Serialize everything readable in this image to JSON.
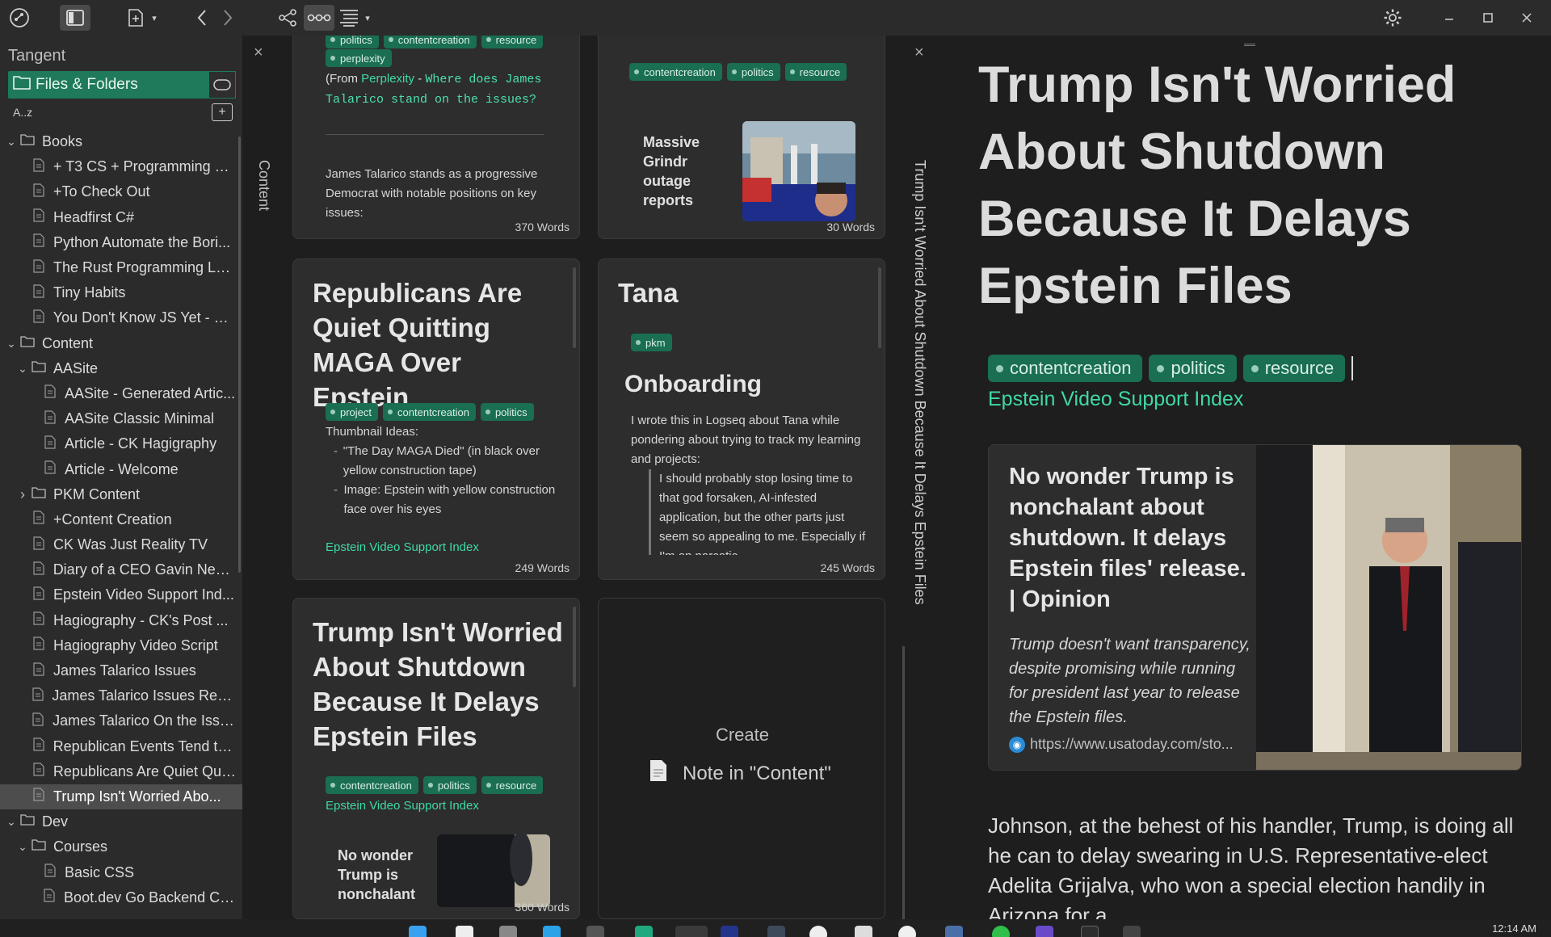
{
  "app": {
    "title": "Tangent"
  },
  "toolbar": {
    "icons": [
      "tangent-logo-icon",
      "sidebar-toggle-icon",
      "new-note-icon",
      "back-icon",
      "forward-icon",
      "graph-icon",
      "link-icon",
      "outline-icon",
      "settings-icon",
      "minimize-icon",
      "maximize-icon",
      "close-icon"
    ]
  },
  "sidebar": {
    "files_tab_label": "Files & Folders",
    "sort_label": "A..z",
    "tree": [
      {
        "label": "Books",
        "type": "folder",
        "depth": 0,
        "expanded": true
      },
      {
        "label": "+ T3 CS + Programming B...",
        "type": "file",
        "depth": 1
      },
      {
        "label": "+To Check Out",
        "type": "file",
        "depth": 1
      },
      {
        "label": "Headfirst C#",
        "type": "file",
        "depth": 1
      },
      {
        "label": "Python Automate the Bori...",
        "type": "file",
        "depth": 1
      },
      {
        "label": "The Rust Programming La...",
        "type": "file",
        "depth": 1
      },
      {
        "label": "Tiny Habits",
        "type": "file",
        "depth": 1
      },
      {
        "label": "You Don't Know JS Yet - G...",
        "type": "file",
        "depth": 1
      },
      {
        "label": "Content",
        "type": "folder",
        "depth": 0,
        "expanded": true
      },
      {
        "label": "AASite",
        "type": "folder",
        "depth": 1,
        "expanded": true
      },
      {
        "label": "AASite - Generated Artic...",
        "type": "file",
        "depth": 2
      },
      {
        "label": "AASite Classic Minimal",
        "type": "file",
        "depth": 2
      },
      {
        "label": "Article - CK Hagigraphy",
        "type": "file",
        "depth": 2
      },
      {
        "label": "Article - Welcome",
        "type": "file",
        "depth": 2
      },
      {
        "label": "PKM Content",
        "type": "folder",
        "depth": 1,
        "expanded": false
      },
      {
        "label": "+Content Creation",
        "type": "file",
        "depth": 1
      },
      {
        "label": "CK Was Just Reality TV",
        "type": "file",
        "depth": 1
      },
      {
        "label": "Diary of a CEO Gavin New...",
        "type": "file",
        "depth": 1
      },
      {
        "label": "Epstein Video Support Ind...",
        "type": "file",
        "depth": 1
      },
      {
        "label": "Hagiography - CK's Post ...",
        "type": "file",
        "depth": 1
      },
      {
        "label": "Hagiography Video Script",
        "type": "file",
        "depth": 1
      },
      {
        "label": "James Talarico Issues",
        "type": "file",
        "depth": 1
      },
      {
        "label": "James Talarico Issues Rewr...",
        "type": "file",
        "depth": 1
      },
      {
        "label": "James Talarico On the Issu...",
        "type": "file",
        "depth": 1
      },
      {
        "label": "Republican Events Tend to...",
        "type": "file",
        "depth": 1
      },
      {
        "label": "Republicans Are Quiet Qui...",
        "type": "file",
        "depth": 1
      },
      {
        "label": "Trump Isn't Worried Abo...",
        "type": "file",
        "depth": 1,
        "selected": true
      },
      {
        "label": "Dev",
        "type": "folder",
        "depth": 0,
        "expanded": true
      },
      {
        "label": "Courses",
        "type": "folder",
        "depth": 1,
        "expanded": true
      },
      {
        "label": "Basic CSS",
        "type": "file",
        "depth": 2
      },
      {
        "label": "Boot.dev Go Backend Co...",
        "type": "file",
        "depth": 2
      }
    ]
  },
  "content_column": {
    "label": "Content"
  },
  "cards": {
    "c1": {
      "tags_top": [
        "politics",
        "contentcreation",
        "resource"
      ],
      "tags_second": [
        "perplexity"
      ],
      "from_prefix": "(From ",
      "from_link": "Perplexity",
      "from_sep": " - ",
      "question": "Where does James Talarico stand on the issues?",
      "body": "James Talarico stands as a progressive Democrat with notable positions on key issues:",
      "words": "370 Words"
    },
    "c2": {
      "tags": [
        "contentcreation",
        "politics",
        "resource"
      ],
      "teaser": "Massive Grindr outage reports coincide",
      "words": "30 Words"
    },
    "c3": {
      "title": "Republicans Are Quiet Quitting MAGA Over Epstein",
      "tags": [
        "project",
        "contentcreation",
        "politics"
      ],
      "thumb_heading": "Thumbnail Ideas:",
      "bullets": [
        "\"The Day MAGA Died\" (in black over yellow construction tape)",
        "Image: Epstein with yellow construction face over his eyes"
      ],
      "link": "Epstein Video Support Index",
      "words": "249 Words"
    },
    "c4": {
      "title": "Tana",
      "tags": [
        "pkm"
      ],
      "subtitle": "Onboarding",
      "body": "I wrote this in Logseq about Tana while pondering about trying to track my learning and projects:",
      "quote": "I should probably stop losing time to that god forsaken, AI-infested application, but the other parts just seem so appealing to me. Especially if I'm on narcotic",
      "words": "245 Words"
    },
    "c5": {
      "title": "Trump Isn't Worried About Shutdown Because It Delays Epstein Files",
      "tags": [
        "contentcreation",
        "politics",
        "resource"
      ],
      "link": "Epstein Video Support Index",
      "teaser": "No wonder Trump is nonchalant",
      "words": "360 Words"
    },
    "create": {
      "line1": "Create",
      "line2": "Note in \"Content\""
    }
  },
  "article": {
    "vertical_title": "Trump Isn't Worried About Shutdown Because It Delays Epstein Files",
    "title": "Trump Isn't Worried About Shutdown Because It Delays Epstein Files",
    "tags": [
      "contentcreation",
      "politics",
      "resource"
    ],
    "link": "Epstein Video Support Index",
    "embed": {
      "title": "No wonder Trump is nonchalant about shutdown. It delays Epstein files' release. | Opinion",
      "description": "Trump doesn't want transparency, despite promising while running for president last year to release the Epstein files.",
      "url": "https://www.usatoday.com/sto..."
    },
    "body": "Johnson, at the behest of his handler, Trump, is doing all he can to delay swearing in U.S. Representative-elect Adelita Grijalva, who won a special election handily in Arizona for a"
  },
  "taskbar": {
    "clock": "12:14 AM"
  },
  "colors": {
    "accent": "#1e7a5a",
    "tag_bg": "#1a6e52",
    "link": "#3fd9a6"
  }
}
